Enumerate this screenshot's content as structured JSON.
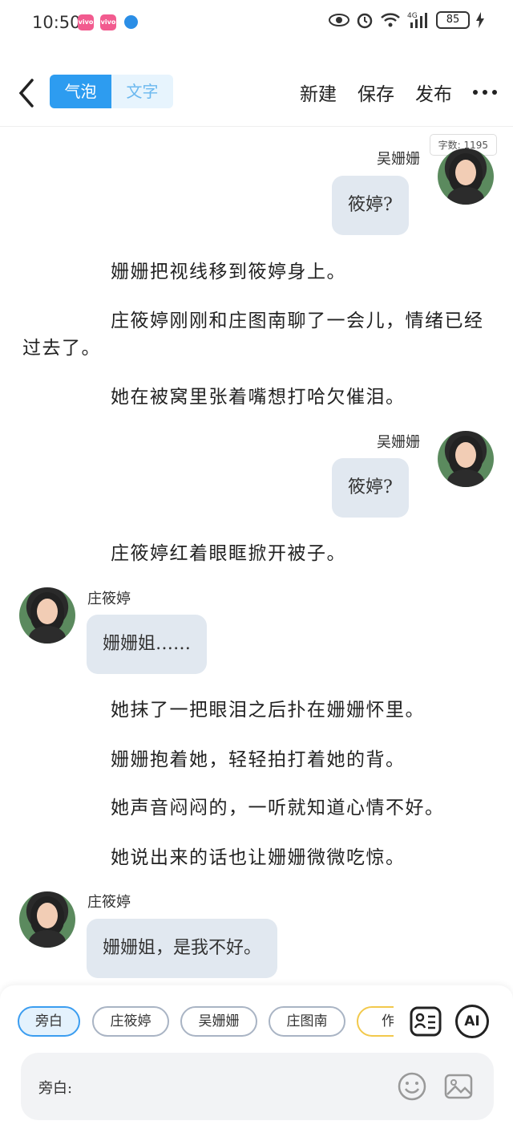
{
  "status": {
    "time": "10:50",
    "battery": "85",
    "network": "4G"
  },
  "header": {
    "tab_bubble": "气泡",
    "tab_text": "文字",
    "new_label": "新建",
    "save_label": "保存",
    "publish_label": "发布"
  },
  "word_count": "字数: 1195",
  "messages": {
    "m1_name": "吴姗姗",
    "m1_text": "筱婷?",
    "n1": "姗姗把视线移到筱婷身上。",
    "n2": "庄筱婷刚刚和庄图南聊了一会儿，情绪已经过去了。",
    "n3": "她在被窝里张着嘴想打哈欠催泪。",
    "m2_name": "吴姗姗",
    "m2_text": "筱婷?",
    "n4": "庄筱婷红着眼眶掀开被子。",
    "m3_name": "庄筱婷",
    "m3_text": "姗姗姐……",
    "n5": "她抹了一把眼泪之后扑在姗姗怀里。",
    "n6": "姗姗抱着她，轻轻拍打着她的背。",
    "n7": "她声音闷闷的，一听就知道心情不好。",
    "n8": "她说出来的话也让姗姗微微吃惊。",
    "m4_name": "庄筱婷",
    "m4_text": "姗姗姐，是我不好。"
  },
  "roles": {
    "r1": "旁白",
    "r2": "庄筱婷",
    "r3": "吴姗姗",
    "r4": "庄图南",
    "r5": "作者"
  },
  "composer": {
    "label": "旁白:"
  },
  "icons": {
    "ai_label": "AI"
  }
}
